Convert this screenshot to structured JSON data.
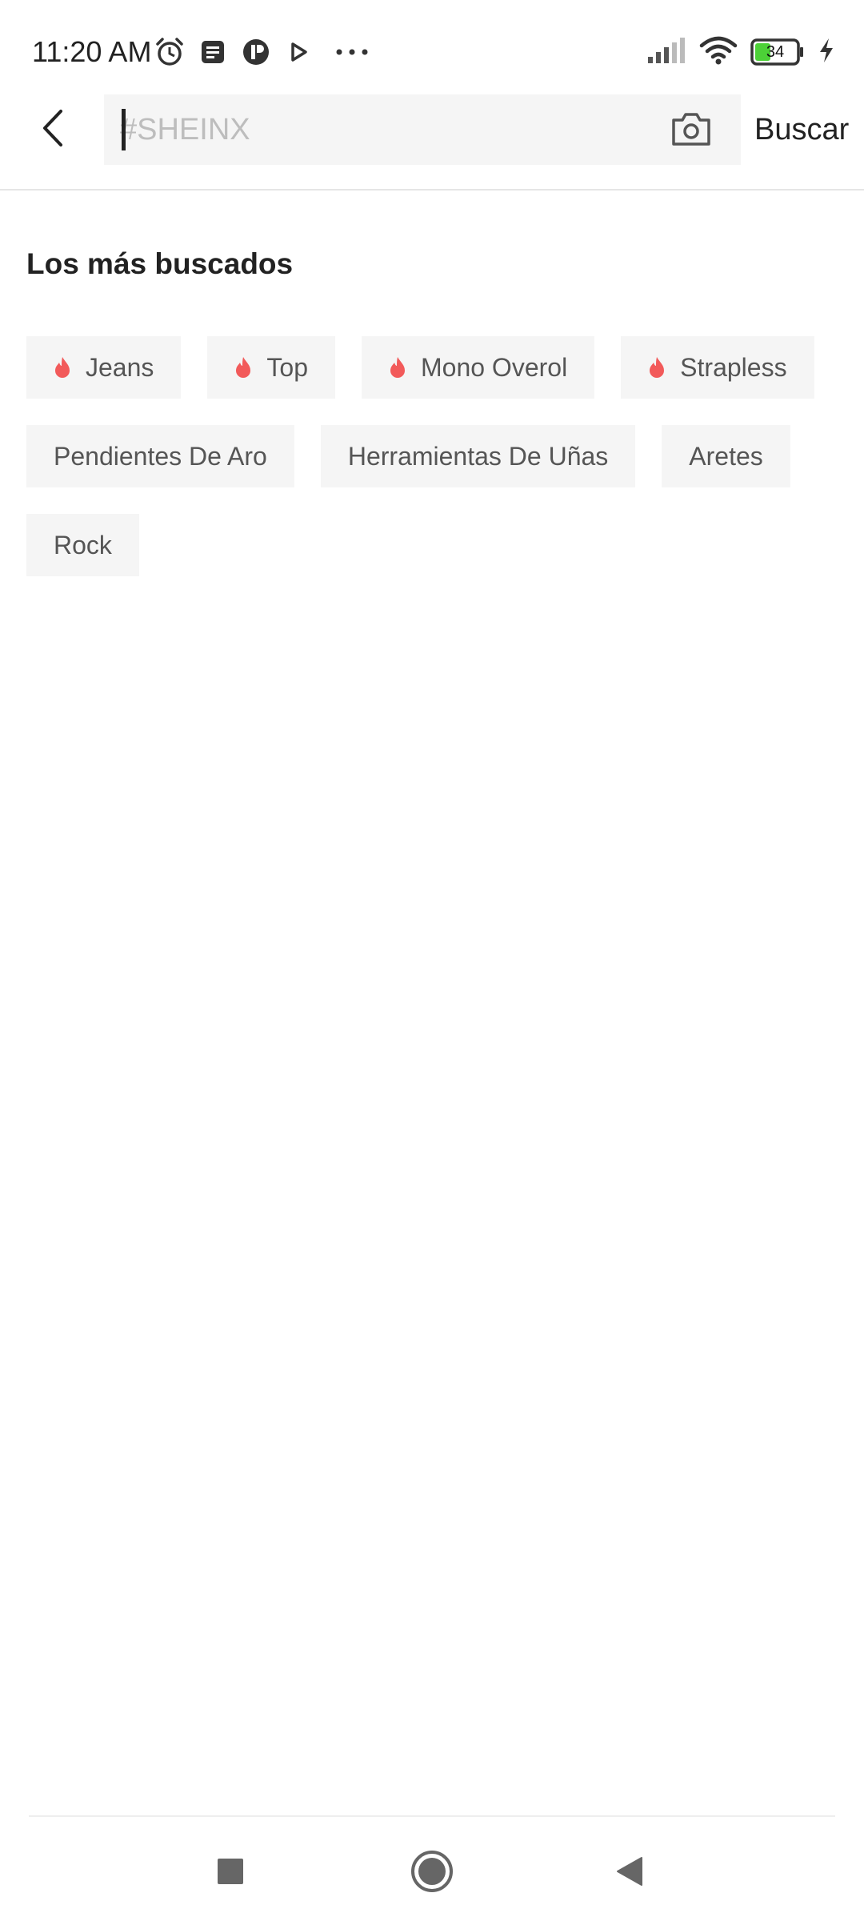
{
  "status_bar": {
    "time": "11:20 AM",
    "battery_level": "34"
  },
  "search": {
    "placeholder": "#SHEINX",
    "value": "",
    "submit_label": "Buscar"
  },
  "trending": {
    "title": "Los más buscados",
    "tags": [
      {
        "label": "Jeans",
        "hot": true
      },
      {
        "label": "Top",
        "hot": true
      },
      {
        "label": "Mono Overol",
        "hot": true
      },
      {
        "label": "Strapless",
        "hot": true
      },
      {
        "label": "Pendientes De Aro",
        "hot": false
      },
      {
        "label": "Herramientas De Uñas",
        "hot": false
      },
      {
        "label": "Aretes",
        "hot": false
      },
      {
        "label": "Rock",
        "hot": false
      }
    ]
  },
  "colors": {
    "accent_flame": "#f25a5a",
    "battery_fill": "#4cd137",
    "tag_background": "#f5f5f5"
  },
  "icons": {
    "status_left": [
      "alarm-icon",
      "notes-icon",
      "app-icon",
      "play-icon",
      "more-dots-icon"
    ],
    "status_right": [
      "signal-icon",
      "wifi-icon",
      "battery-icon",
      "charging-icon"
    ],
    "header": [
      "back-arrow-icon",
      "camera-icon"
    ],
    "nav": [
      "recents-square-icon",
      "home-circle-icon",
      "back-triangle-icon"
    ]
  }
}
